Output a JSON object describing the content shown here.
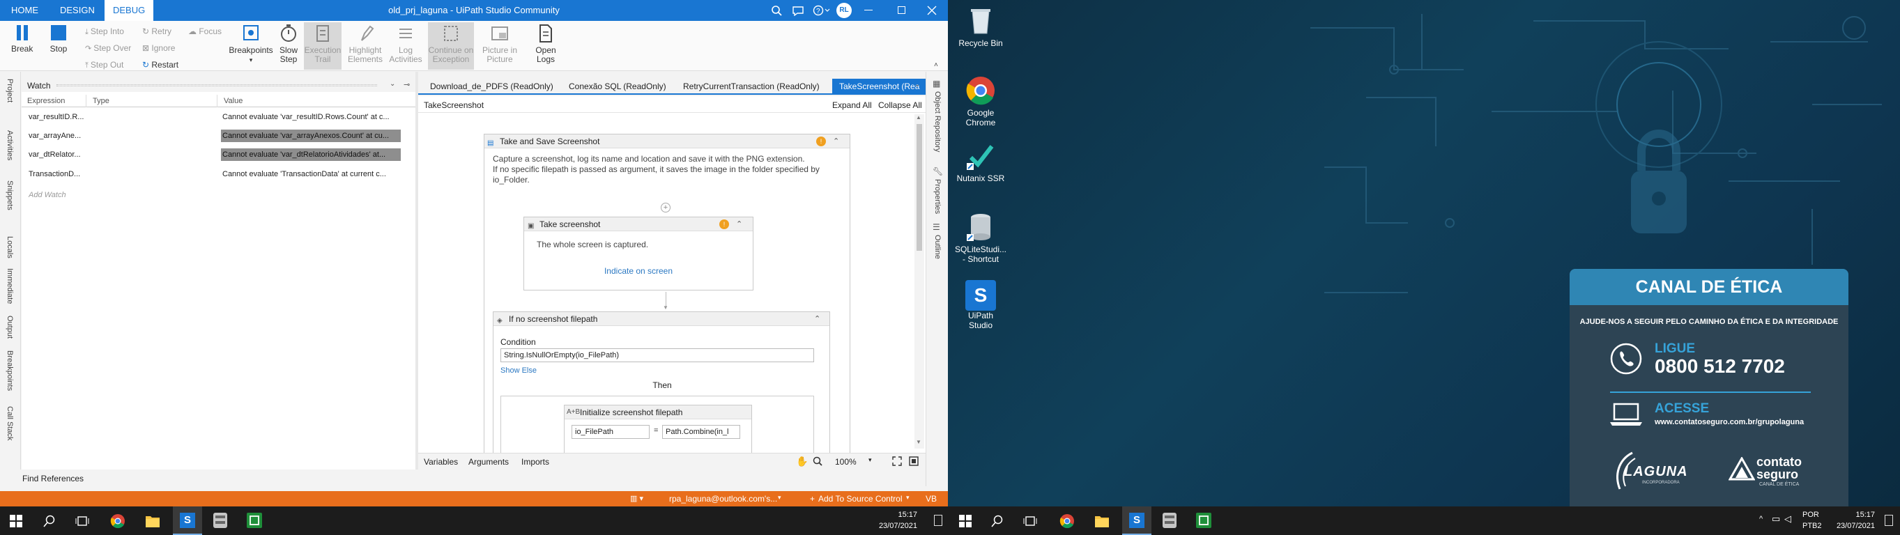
{
  "titlebar": {
    "tabs": [
      "HOME",
      "DESIGN",
      "DEBUG"
    ],
    "title": "old_prj_laguna - UiPath Studio Community",
    "user_initials": "RL"
  },
  "ribbon": {
    "break": "Break",
    "stop": "Stop",
    "step_into": "Step Into",
    "step_over": "Step Over",
    "step_out": "Step Out",
    "retry": "Retry",
    "ignore": "Ignore",
    "restart": "Restart",
    "focus": "Focus",
    "breakpoints": "Breakpoints",
    "slow_step_1": "Slow",
    "slow_step_2": "Step",
    "execution_trail_1": "Execution",
    "execution_trail_2": "Trail",
    "highlight_1": "Highlight",
    "highlight_2": "Elements",
    "log_1": "Log",
    "log_2": "Activities",
    "continue_1": "Continue on",
    "continue_2": "Exception",
    "pip_1": "Picture in",
    "pip_2": "Picture",
    "open_logs_1": "Open",
    "open_logs_2": "Logs"
  },
  "left_vertical_tabs": [
    "Project",
    "Activities",
    "Snippets",
    "Locals",
    "Immediate",
    "Output",
    "Breakpoints",
    "Call Stack"
  ],
  "right_vertical_tabs": [
    "Object Repository",
    "Properties",
    "Outline"
  ],
  "watch": {
    "title": "Watch",
    "columns": [
      "Expression",
      "Type",
      "Value"
    ],
    "rows": [
      {
        "expression": "var_resultID.R...",
        "type": "",
        "value": "Cannot evaluate 'var_resultID.Rows.Count' at c...",
        "highlight": false
      },
      {
        "expression": "var_arrayAne...",
        "type": "",
        "value": "Cannot evaluate 'var_arrayAnexos.Count' at cu...",
        "highlight": true
      },
      {
        "expression": "var_dtRelator...",
        "type": "",
        "value": "Cannot evaluate 'var_dtRelatorioAtividades' at...",
        "highlight": true
      },
      {
        "expression": "TransactionD...",
        "type": "",
        "value": "Cannot evaluate 'TransactionData' at current c...",
        "highlight": false
      }
    ],
    "add_watch": "Add Watch"
  },
  "doc_tabs": [
    "Download_de_PDFS (ReadOnly)",
    "Conexão SQL (ReadOnly)",
    "RetryCurrentTransaction (ReadOnly)",
    "TakeScreenshot (Rea"
  ],
  "designer": {
    "breadcrumb": "TakeScreenshot",
    "expand_all": "Expand All",
    "collapse_all": "Collapse All",
    "sequence_title": "Take and Save Screenshot",
    "sequence_desc_1": "Capture a screenshot, log its name and location and save it with the PNG extension.",
    "sequence_desc_2": "If no specific filepath is passed as argument, it saves the image in the folder specified by",
    "sequence_desc_3": "io_Folder.",
    "take_title": "Take screenshot",
    "take_desc": "The whole screen is captured.",
    "indicate": "Indicate on screen",
    "if_title": "If no screenshot filepath",
    "condition_label": "Condition",
    "condition_value": "String.IsNullOrEmpty(io_FilePath)",
    "show_else": "Show Else",
    "then_label": "Then",
    "init_title": "Initialize screenshot filepath",
    "assign_left": "io_FilePath",
    "assign_eq": "=",
    "assign_right": "Path.Combine(in_l"
  },
  "designer_footer": {
    "variables": "Variables",
    "arguments": "Arguments",
    "imports": "Imports",
    "zoom": "100%"
  },
  "find_references": "Find References",
  "statusbar": {
    "account": "rpa_laguna@outlook.com's...",
    "source_control": "Add To Source Control",
    "vb": "VB"
  },
  "taskbar_left": {
    "time": "15:17",
    "date": "23/07/2021"
  },
  "taskbar_right": {
    "lang_1": "POR",
    "lang_2": "PTB2",
    "time": "15:17",
    "date": "23/07/2021"
  },
  "desktop_icons": [
    {
      "label_1": "Recycle Bin",
      "label_2": ""
    },
    {
      "label_1": "Google",
      "label_2": "Chrome"
    },
    {
      "label_1": "Nutanix SSR",
      "label_2": ""
    },
    {
      "label_1": "SQLiteStudi...",
      "label_2": "- Shortcut"
    },
    {
      "label_1": "UiPath",
      "label_2": "Studio"
    }
  ],
  "ethics_card": {
    "title": "CANAL DE ÉTICA",
    "subtitle": "AJUDE-NOS A SEGUIR PELO CAMINHO DA ÉTICA E DA INTEGRIDADE",
    "ligue_label": "LIGUE",
    "phone": "0800 512 7702",
    "acesse_label": "ACESSE",
    "url": "www.contatoseguro.com.br/grupolaguna",
    "logo_left": "LAGUNA",
    "logo_left_sub": "INCORPORADORA",
    "logo_right_1": "contato",
    "logo_right_2": "seguro",
    "logo_right_sub": "CANAL DE ÉTICA"
  }
}
